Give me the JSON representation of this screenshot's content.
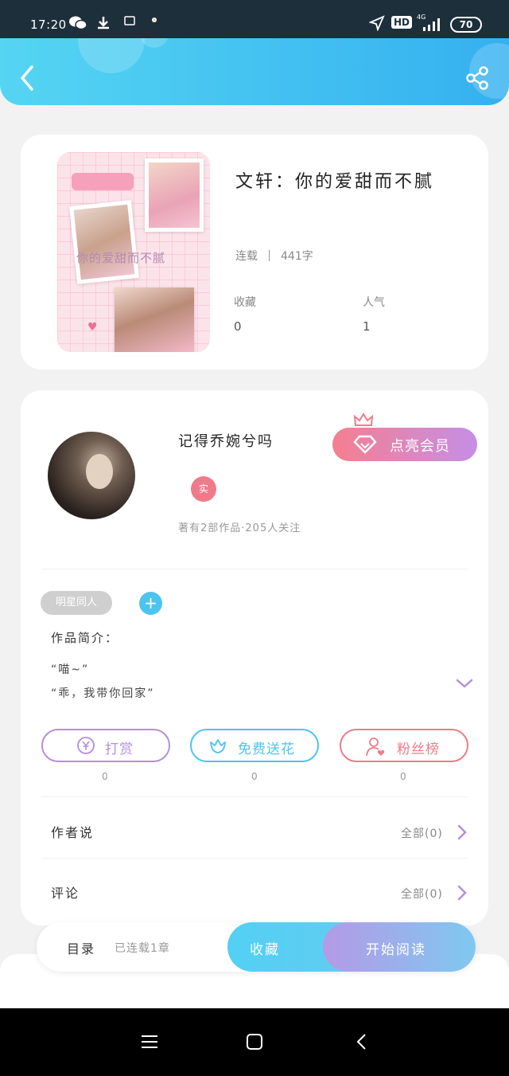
{
  "status_bar": {
    "time": "17:20",
    "network": "HD",
    "signal": "4G",
    "battery": "70"
  },
  "header": {
    "back_icon": "chevron-left-icon",
    "share_icon": "share-icon",
    "colors": {
      "gradient_start": "#55d5f2",
      "gradient_end": "#35b0f0"
    }
  },
  "book": {
    "cover_text": "你的爱甜而不腻",
    "title": "文轩：你的爱甜而不腻",
    "status": "连载",
    "word_count": "441字",
    "stats": [
      {
        "label": "收藏",
        "value": "0"
      },
      {
        "label": "人气",
        "value": "1"
      }
    ]
  },
  "author": {
    "name": "记得乔婉兮吗",
    "badge": "实",
    "stats": "著有2部作品·205人关注",
    "vip_button": "点亮会员"
  },
  "tags": {
    "items": [
      "明星同人"
    ],
    "add_icon": "plus-icon"
  },
  "intro": {
    "label": "作品简介：",
    "lines": [
      "“喵~”",
      "“乖，我带你回家”"
    ]
  },
  "actions": [
    {
      "label": "打赏",
      "count": "0",
      "icon": "yen-coin-icon",
      "color": "#b48ee0"
    },
    {
      "label": "免费送花",
      "count": "0",
      "icon": "flower-icon",
      "color": "#4cc4f0"
    },
    {
      "label": "粉丝榜",
      "count": "0",
      "icon": "user-heart-icon",
      "color": "#f07a8a"
    }
  ],
  "rows": {
    "author_says": {
      "label": "作者说",
      "value": "全部(0)"
    },
    "comments": {
      "label": "评论",
      "value": "全部(0)"
    }
  },
  "bottom_bar": {
    "toc_label": "目录",
    "toc_status": "已连载1章",
    "favorite": "收藏",
    "read": "开始阅读"
  },
  "nav": {
    "menu_icon": "menu-icon",
    "home_icon": "home-square-icon",
    "back_icon": "nav-back-icon"
  }
}
